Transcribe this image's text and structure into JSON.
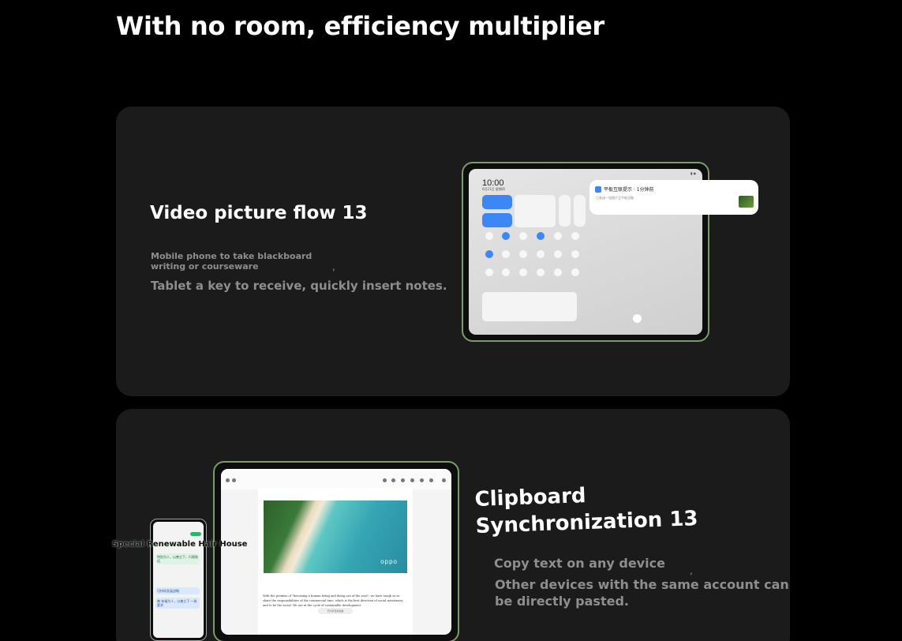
{
  "header": {
    "title": "With no room, efficiency multiplier"
  },
  "feature1": {
    "title": "Video picture flow 13",
    "small_text": "Mobile phone to take blackboard writing or courseware",
    "comma": ",",
    "description": "Tablet a key to receive, quickly insert notes.",
    "tablet": {
      "clock": "10:00",
      "date": "6月21日 星期四",
      "notification_title": "平板互联提示 · 1分钟前",
      "notification_sub": "已发送一张图片至平板设备"
    }
  },
  "feature2": {
    "title_line1": "Clipboard",
    "title_line2": "Synchronization 13",
    "line1": "Copy text on any device",
    "comma": ",",
    "line2": "Other devices with the same account can be directly pasted.",
    "tablet": {
      "brand": "oppo",
      "body_text": "With the premise of \"becoming a human being and doing can of the seas\", we have tough so so share the responsibilities of the commercial time, which is the best direction of social missionary and to be the social. We are at the cycle of sustainable development.",
      "pill_label": "已同步至剪贴板"
    },
    "phone": {
      "overlay_label": "Special Renewable Hair House",
      "bubble1": "特别为人，以善立下，行稳致远",
      "bubble2": "可持续发展战略",
      "bubble3": "善 有福为人，以善立下 一致 要求"
    }
  },
  "colors": {
    "accent_green": "#7c9a6a",
    "card_bg": "#1b1b1b",
    "muted_text": "#8e8e8e"
  }
}
